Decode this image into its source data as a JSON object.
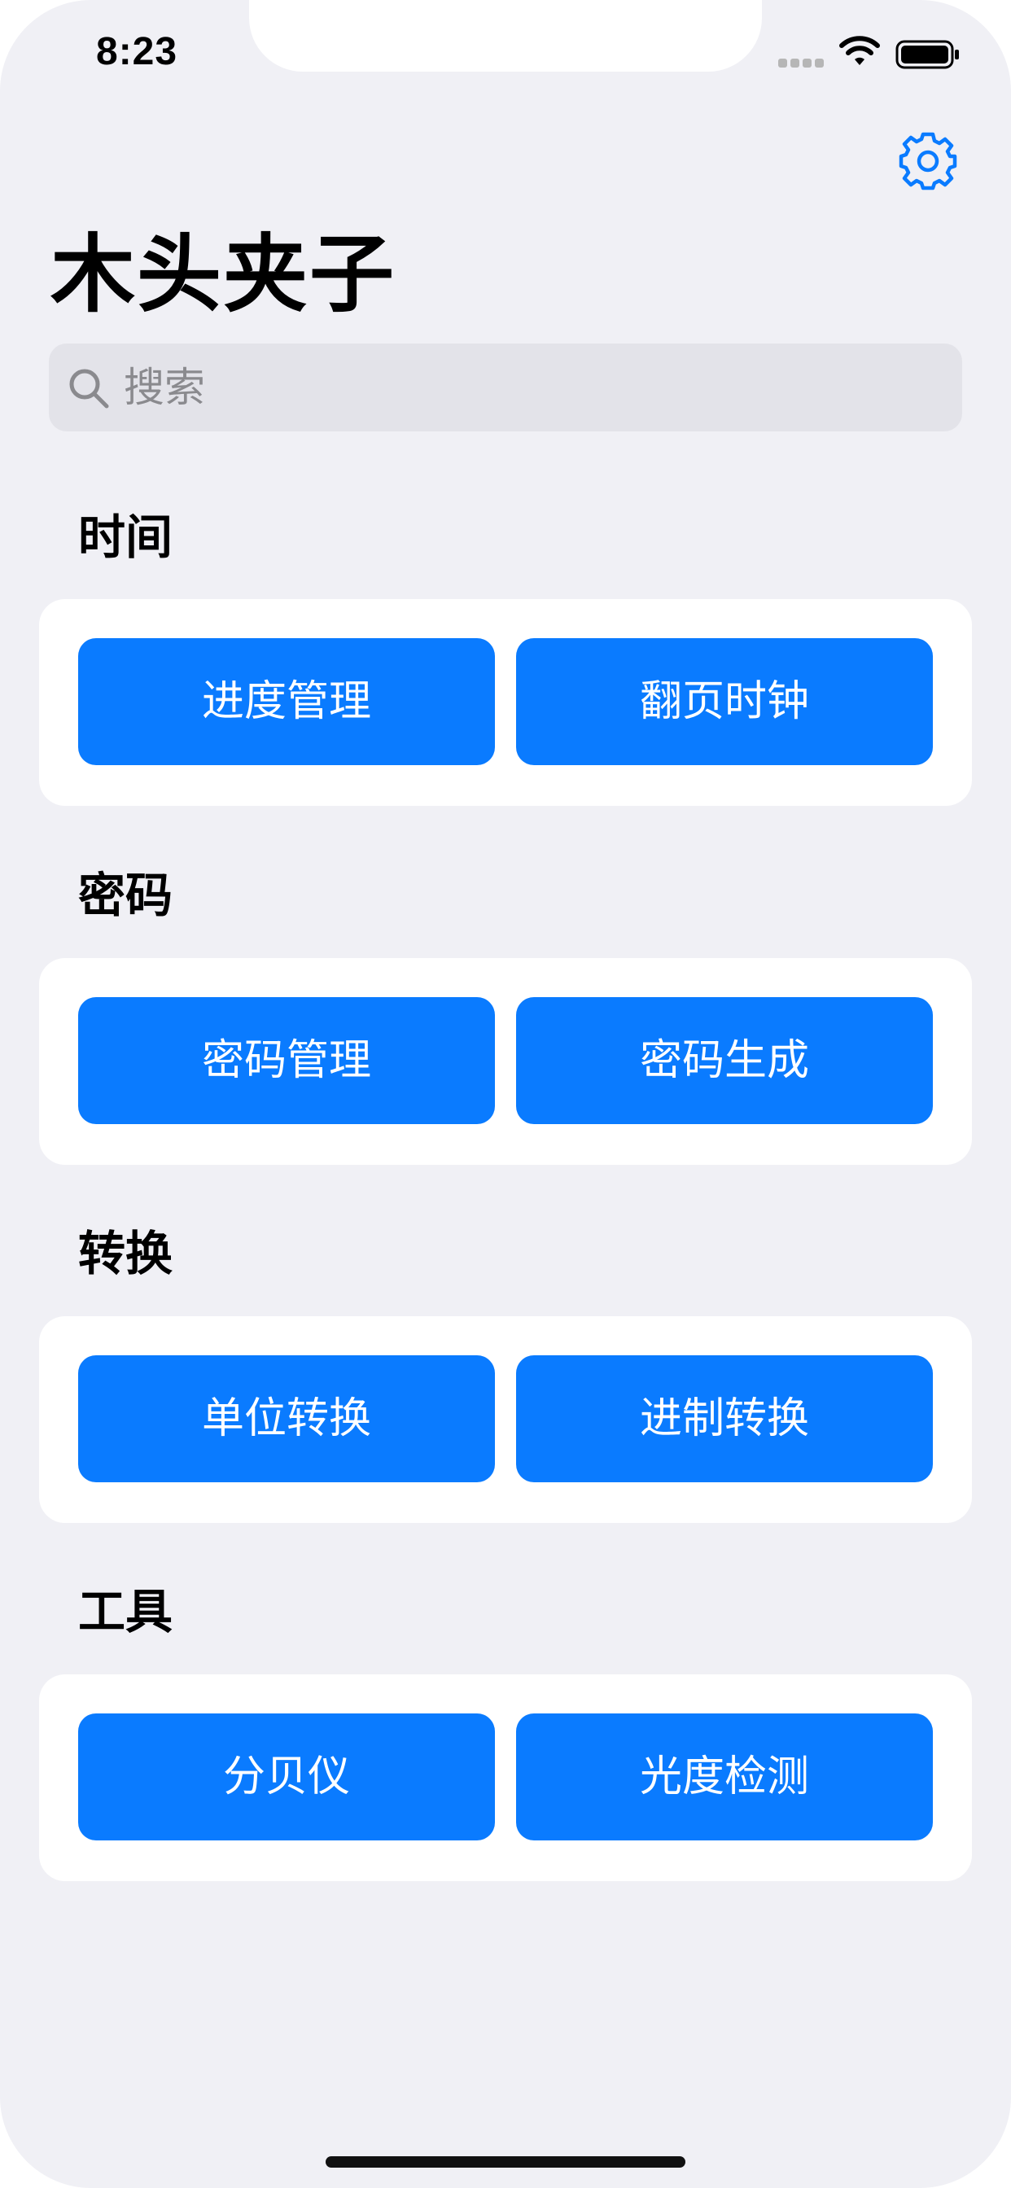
{
  "status_bar": {
    "time": "8:23",
    "signal_icon": "cellular-signal-icon",
    "wifi_icon": "wifi-icon",
    "battery_icon": "battery-icon"
  },
  "header": {
    "title": "木头夹子",
    "settings_icon": "gear-icon",
    "accent_color": "#0a7bff"
  },
  "search": {
    "placeholder": "搜索",
    "icon": "search-icon"
  },
  "sections": [
    {
      "title": "时间",
      "buttons": [
        "进度管理",
        "翻页时钟"
      ]
    },
    {
      "title": "密码",
      "buttons": [
        "密码管理",
        "密码生成"
      ]
    },
    {
      "title": "转换",
      "buttons": [
        "单位转换",
        "进制转换"
      ]
    },
    {
      "title": "工具",
      "buttons": [
        "分贝仪",
        "光度检测"
      ]
    }
  ],
  "colors": {
    "background": "#f0f0f5",
    "card": "#ffffff",
    "button": "#0a7bff",
    "search_bg": "#e3e3e9"
  }
}
